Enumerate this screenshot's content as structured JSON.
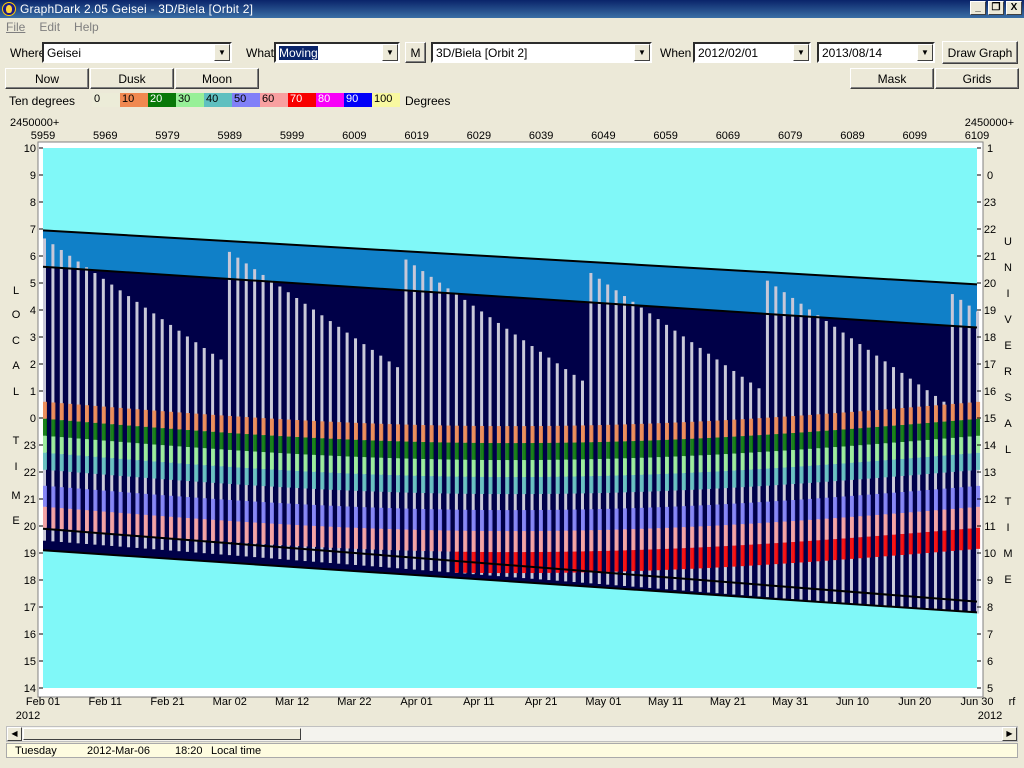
{
  "window": {
    "title": "GraphDark 2.05  Geisei  -  3D/Biela [Orbit 2]",
    "buttons": [
      "_",
      "❐",
      "X"
    ]
  },
  "menu": [
    "File",
    "Edit",
    "Help"
  ],
  "toolbar": {
    "where_label": "Where",
    "where_value": "Geisei",
    "what_label": "What",
    "what_value": "Moving",
    "m_button": "M",
    "object_value": "3D/Biela [Orbit 2]",
    "when_label": "When",
    "start_date": "2012/02/01",
    "end_date": "2013/08/14",
    "draw_button": "Draw Graph"
  },
  "toolbar2": {
    "now": "Now",
    "dusk": "Dusk",
    "moon": "Moon",
    "mask": "Mask",
    "grids": "Grids"
  },
  "scale": {
    "left_label": "Ten degrees",
    "right_label": "Degrees",
    "items": [
      {
        "label": "0",
        "color": "#ececd8"
      },
      {
        "label": "10",
        "color": "#f08850"
      },
      {
        "label": "20",
        "color": "#087808"
      },
      {
        "label": "30",
        "color": "#98f098"
      },
      {
        "label": "40",
        "color": "#60c0c0"
      },
      {
        "label": "50",
        "color": "#8080f8"
      },
      {
        "label": "60",
        "color": "#f8a0a0"
      },
      {
        "label": "70",
        "color": "#f80000"
      },
      {
        "label": "80",
        "color": "#f800f8"
      },
      {
        "label": "90",
        "color": "#0000f8"
      },
      {
        "label": "100",
        "color": "#f8f8a0"
      }
    ]
  },
  "chart_data": {
    "type": "heatmap",
    "jd_prefix_left": "2450000+",
    "jd_prefix_right": "2450000+",
    "jd_ticks": [
      "5959",
      "5969",
      "5979",
      "5989",
      "5999",
      "6009",
      "6019",
      "6029",
      "6039",
      "6049",
      "6059",
      "6069",
      "6079",
      "6089",
      "6099",
      "6109"
    ],
    "date_ticks": [
      "Feb 01",
      "Feb 11",
      "Feb 21",
      "Mar 02",
      "Mar 12",
      "Mar 22",
      "Apr 01",
      "Apr 11",
      "Apr 21",
      "May 01",
      "May 11",
      "May 21",
      "May 31",
      "Jun 10",
      "Jun 20",
      "Jun 30"
    ],
    "year_left": "2012",
    "year_right": "2012",
    "right_corner_label": "rf",
    "left_ticks": [
      "10",
      "9",
      "8",
      "7",
      "6",
      "5",
      "4",
      "3",
      "2",
      "1",
      "0",
      "23",
      "22",
      "21",
      "20",
      "19",
      "18",
      "17",
      "16",
      "15",
      "14"
    ],
    "right_ticks": [
      "1",
      "0",
      "23",
      "22",
      "21",
      "20",
      "19",
      "18",
      "17",
      "16",
      "15",
      "14",
      "13",
      "12",
      "11",
      "10",
      "9",
      "8",
      "7",
      "6",
      "5"
    ],
    "left_axis_label": "LOCAL TIME",
    "right_axis_label_top": "UNIVERSAL",
    "right_axis_label_bottom": "TIME",
    "colors": {
      "daylight": "#80f8f8",
      "twilight": "#1080c8",
      "night": "#000048",
      "altitude_bar": "#c8c8d8"
    },
    "series": [
      {
        "name": "sunset",
        "x": [
          0,
          150
        ],
        "y": [
          19.9,
          17.2
        ]
      },
      {
        "name": "sunrise",
        "x": [
          0,
          150
        ],
        "y": [
          6.95,
          4.95
        ]
      },
      {
        "name": "dusk",
        "x": [
          0,
          150
        ],
        "y": [
          19.1,
          16.8
        ]
      },
      {
        "name": "dawn",
        "x": [
          0,
          150
        ],
        "y": [
          5.6,
          3.35
        ]
      }
    ]
  },
  "status": {
    "day": "Tuesday",
    "date": "2012-Mar-06",
    "time": "18:20",
    "note": "Local time"
  }
}
